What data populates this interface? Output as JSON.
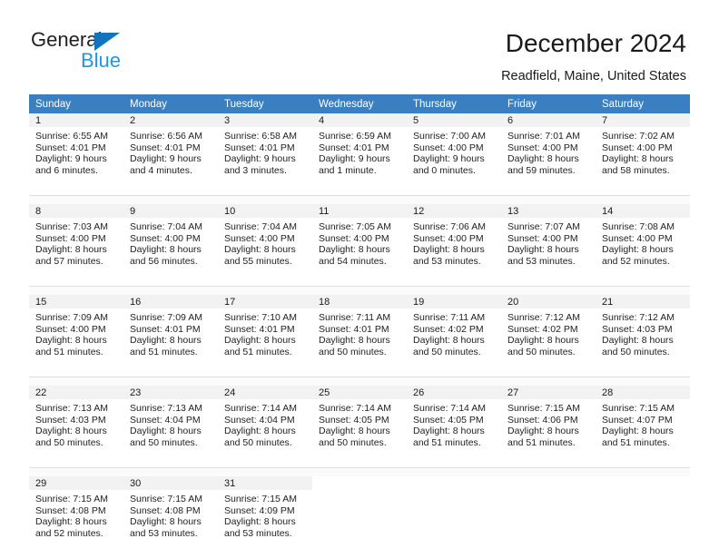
{
  "brand": {
    "name_part1": "General",
    "name_part2": "Blue",
    "accent_color": "#2196e3",
    "triangle_color": "#1274bc"
  },
  "header": {
    "title": "December 2024",
    "location": "Readfield, Maine, United States"
  },
  "theme": {
    "header_row_color": "#3a7fc1",
    "daynum_band_color": "#f2f2f2",
    "text_color": "#1a1a1a"
  },
  "weekdays": [
    "Sunday",
    "Monday",
    "Tuesday",
    "Wednesday",
    "Thursday",
    "Friday",
    "Saturday"
  ],
  "weeks": [
    [
      {
        "day": "1",
        "sunrise": "Sunrise: 6:55 AM",
        "sunset": "Sunset: 4:01 PM",
        "daylight_line1": "Daylight: 9 hours",
        "daylight_line2": "and 6 minutes."
      },
      {
        "day": "2",
        "sunrise": "Sunrise: 6:56 AM",
        "sunset": "Sunset: 4:01 PM",
        "daylight_line1": "Daylight: 9 hours",
        "daylight_line2": "and 4 minutes."
      },
      {
        "day": "3",
        "sunrise": "Sunrise: 6:58 AM",
        "sunset": "Sunset: 4:01 PM",
        "daylight_line1": "Daylight: 9 hours",
        "daylight_line2": "and 3 minutes."
      },
      {
        "day": "4",
        "sunrise": "Sunrise: 6:59 AM",
        "sunset": "Sunset: 4:01 PM",
        "daylight_line1": "Daylight: 9 hours",
        "daylight_line2": "and 1 minute."
      },
      {
        "day": "5",
        "sunrise": "Sunrise: 7:00 AM",
        "sunset": "Sunset: 4:00 PM",
        "daylight_line1": "Daylight: 9 hours",
        "daylight_line2": "and 0 minutes."
      },
      {
        "day": "6",
        "sunrise": "Sunrise: 7:01 AM",
        "sunset": "Sunset: 4:00 PM",
        "daylight_line1": "Daylight: 8 hours",
        "daylight_line2": "and 59 minutes."
      },
      {
        "day": "7",
        "sunrise": "Sunrise: 7:02 AM",
        "sunset": "Sunset: 4:00 PM",
        "daylight_line1": "Daylight: 8 hours",
        "daylight_line2": "and 58 minutes."
      }
    ],
    [
      {
        "day": "8",
        "sunrise": "Sunrise: 7:03 AM",
        "sunset": "Sunset: 4:00 PM",
        "daylight_line1": "Daylight: 8 hours",
        "daylight_line2": "and 57 minutes."
      },
      {
        "day": "9",
        "sunrise": "Sunrise: 7:04 AM",
        "sunset": "Sunset: 4:00 PM",
        "daylight_line1": "Daylight: 8 hours",
        "daylight_line2": "and 56 minutes."
      },
      {
        "day": "10",
        "sunrise": "Sunrise: 7:04 AM",
        "sunset": "Sunset: 4:00 PM",
        "daylight_line1": "Daylight: 8 hours",
        "daylight_line2": "and 55 minutes."
      },
      {
        "day": "11",
        "sunrise": "Sunrise: 7:05 AM",
        "sunset": "Sunset: 4:00 PM",
        "daylight_line1": "Daylight: 8 hours",
        "daylight_line2": "and 54 minutes."
      },
      {
        "day": "12",
        "sunrise": "Sunrise: 7:06 AM",
        "sunset": "Sunset: 4:00 PM",
        "daylight_line1": "Daylight: 8 hours",
        "daylight_line2": "and 53 minutes."
      },
      {
        "day": "13",
        "sunrise": "Sunrise: 7:07 AM",
        "sunset": "Sunset: 4:00 PM",
        "daylight_line1": "Daylight: 8 hours",
        "daylight_line2": "and 53 minutes."
      },
      {
        "day": "14",
        "sunrise": "Sunrise: 7:08 AM",
        "sunset": "Sunset: 4:00 PM",
        "daylight_line1": "Daylight: 8 hours",
        "daylight_line2": "and 52 minutes."
      }
    ],
    [
      {
        "day": "15",
        "sunrise": "Sunrise: 7:09 AM",
        "sunset": "Sunset: 4:00 PM",
        "daylight_line1": "Daylight: 8 hours",
        "daylight_line2": "and 51 minutes."
      },
      {
        "day": "16",
        "sunrise": "Sunrise: 7:09 AM",
        "sunset": "Sunset: 4:01 PM",
        "daylight_line1": "Daylight: 8 hours",
        "daylight_line2": "and 51 minutes."
      },
      {
        "day": "17",
        "sunrise": "Sunrise: 7:10 AM",
        "sunset": "Sunset: 4:01 PM",
        "daylight_line1": "Daylight: 8 hours",
        "daylight_line2": "and 51 minutes."
      },
      {
        "day": "18",
        "sunrise": "Sunrise: 7:11 AM",
        "sunset": "Sunset: 4:01 PM",
        "daylight_line1": "Daylight: 8 hours",
        "daylight_line2": "and 50 minutes."
      },
      {
        "day": "19",
        "sunrise": "Sunrise: 7:11 AM",
        "sunset": "Sunset: 4:02 PM",
        "daylight_line1": "Daylight: 8 hours",
        "daylight_line2": "and 50 minutes."
      },
      {
        "day": "20",
        "sunrise": "Sunrise: 7:12 AM",
        "sunset": "Sunset: 4:02 PM",
        "daylight_line1": "Daylight: 8 hours",
        "daylight_line2": "and 50 minutes."
      },
      {
        "day": "21",
        "sunrise": "Sunrise: 7:12 AM",
        "sunset": "Sunset: 4:03 PM",
        "daylight_line1": "Daylight: 8 hours",
        "daylight_line2": "and 50 minutes."
      }
    ],
    [
      {
        "day": "22",
        "sunrise": "Sunrise: 7:13 AM",
        "sunset": "Sunset: 4:03 PM",
        "daylight_line1": "Daylight: 8 hours",
        "daylight_line2": "and 50 minutes."
      },
      {
        "day": "23",
        "sunrise": "Sunrise: 7:13 AM",
        "sunset": "Sunset: 4:04 PM",
        "daylight_line1": "Daylight: 8 hours",
        "daylight_line2": "and 50 minutes."
      },
      {
        "day": "24",
        "sunrise": "Sunrise: 7:14 AM",
        "sunset": "Sunset: 4:04 PM",
        "daylight_line1": "Daylight: 8 hours",
        "daylight_line2": "and 50 minutes."
      },
      {
        "day": "25",
        "sunrise": "Sunrise: 7:14 AM",
        "sunset": "Sunset: 4:05 PM",
        "daylight_line1": "Daylight: 8 hours",
        "daylight_line2": "and 50 minutes."
      },
      {
        "day": "26",
        "sunrise": "Sunrise: 7:14 AM",
        "sunset": "Sunset: 4:05 PM",
        "daylight_line1": "Daylight: 8 hours",
        "daylight_line2": "and 51 minutes."
      },
      {
        "day": "27",
        "sunrise": "Sunrise: 7:15 AM",
        "sunset": "Sunset: 4:06 PM",
        "daylight_line1": "Daylight: 8 hours",
        "daylight_line2": "and 51 minutes."
      },
      {
        "day": "28",
        "sunrise": "Sunrise: 7:15 AM",
        "sunset": "Sunset: 4:07 PM",
        "daylight_line1": "Daylight: 8 hours",
        "daylight_line2": "and 51 minutes."
      }
    ],
    [
      {
        "day": "29",
        "sunrise": "Sunrise: 7:15 AM",
        "sunset": "Sunset: 4:08 PM",
        "daylight_line1": "Daylight: 8 hours",
        "daylight_line2": "and 52 minutes."
      },
      {
        "day": "30",
        "sunrise": "Sunrise: 7:15 AM",
        "sunset": "Sunset: 4:08 PM",
        "daylight_line1": "Daylight: 8 hours",
        "daylight_line2": "and 53 minutes."
      },
      {
        "day": "31",
        "sunrise": "Sunrise: 7:15 AM",
        "sunset": "Sunset: 4:09 PM",
        "daylight_line1": "Daylight: 8 hours",
        "daylight_line2": "and 53 minutes."
      },
      {
        "day": "",
        "sunrise": "",
        "sunset": "",
        "daylight_line1": "",
        "daylight_line2": ""
      },
      {
        "day": "",
        "sunrise": "",
        "sunset": "",
        "daylight_line1": "",
        "daylight_line2": ""
      },
      {
        "day": "",
        "sunrise": "",
        "sunset": "",
        "daylight_line1": "",
        "daylight_line2": ""
      },
      {
        "day": "",
        "sunrise": "",
        "sunset": "",
        "daylight_line1": "",
        "daylight_line2": ""
      }
    ]
  ]
}
